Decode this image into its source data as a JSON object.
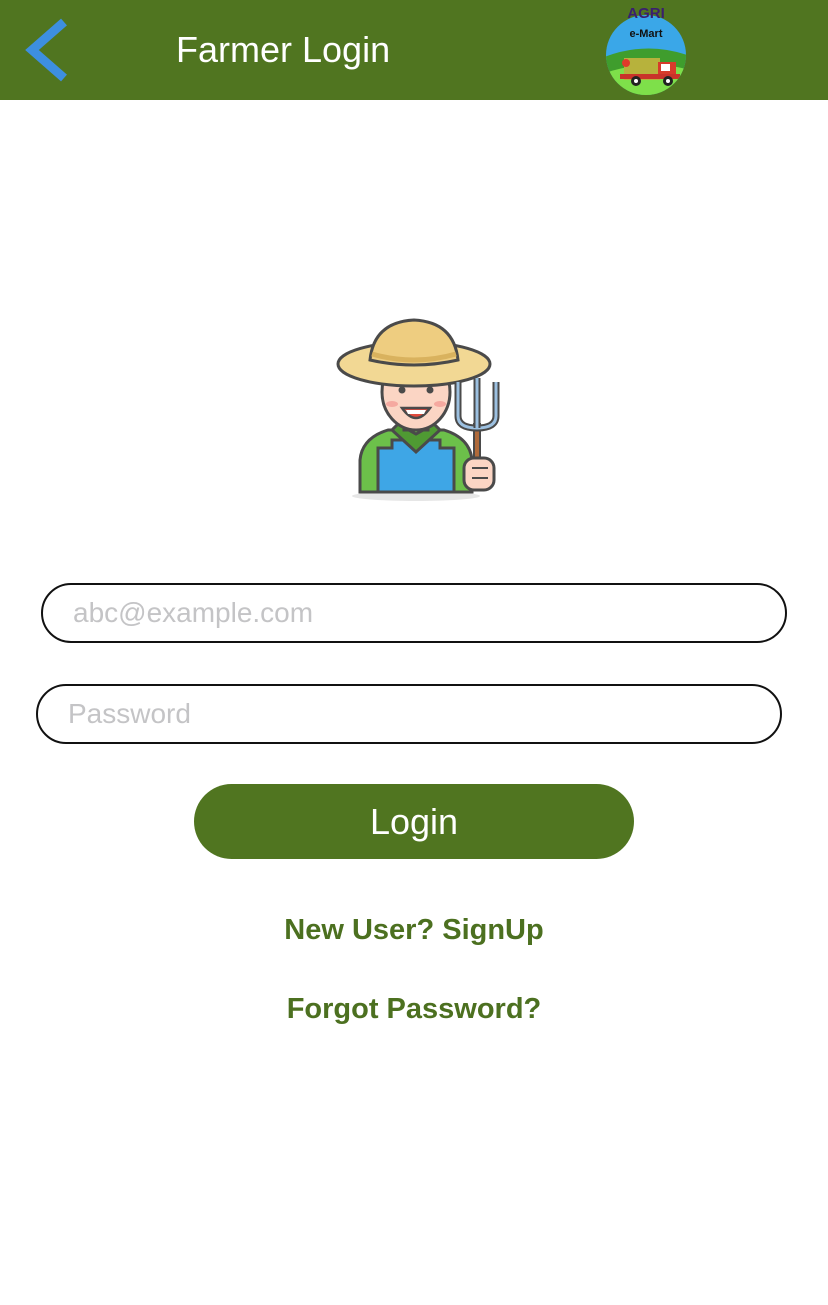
{
  "header": {
    "title": "Farmer Login",
    "logo_top_text": "AGRI",
    "logo_badge_text": "e-Mart"
  },
  "form": {
    "email_placeholder": "abc@example.com",
    "password_placeholder": "Password",
    "login_label": "Login"
  },
  "links": {
    "signup": "New User? SignUp",
    "forgot": "Forgot Password?"
  },
  "icons": {
    "back": "chevron-left-icon",
    "logo": "agri-emart-logo",
    "avatar": "farmer-avatar-icon"
  },
  "colors": {
    "header_bg": "#507520",
    "back_chevron": "#3d8fe0",
    "link_text": "#4c7020"
  }
}
